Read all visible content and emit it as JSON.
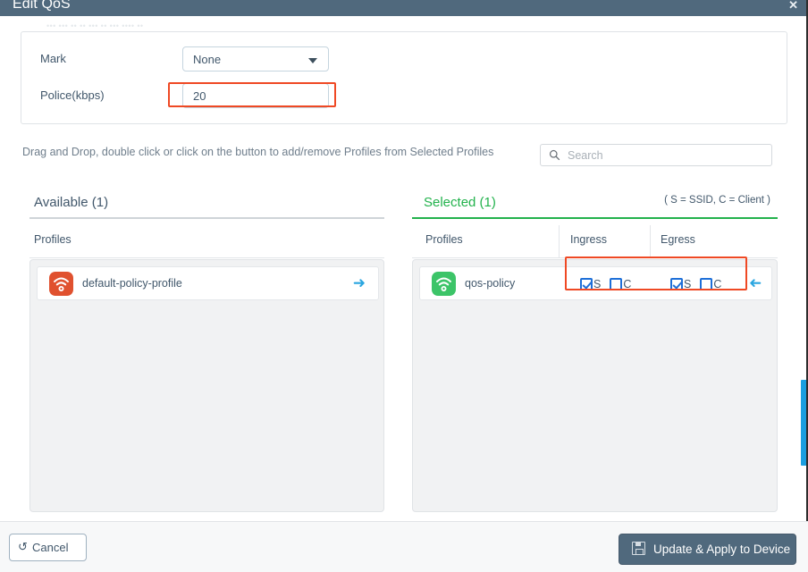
{
  "window": {
    "title": "Edit QoS",
    "close_label": "✕"
  },
  "ghost": {
    "text": "•••  •••  ••  ••    •••   •• ••• •••• ••"
  },
  "form": {
    "mark": {
      "label": "Mark",
      "value": "None",
      "caret_icon": "chevron-down-icon"
    },
    "police": {
      "label": "Police(kbps)",
      "value": "20"
    }
  },
  "instructions": {
    "text": "Drag and Drop, double click or click on the button to add/remove Profiles from Selected Profiles"
  },
  "search": {
    "icon": "search-icon",
    "value": "",
    "placeholder": "Search"
  },
  "available_panel": {
    "heading": "Available (1)",
    "column_header": "Profiles",
    "rows": [
      {
        "name": "default-policy-profile",
        "icon": "wifi-profile-icon",
        "icon_color": "#e0512f",
        "move_icon": "arrow-right-icon",
        "move_icon_glyph": "➜"
      }
    ]
  },
  "selected_panel": {
    "heading": "Selected (1)",
    "legend": "( S = SSID, C = Client )",
    "column_headers": {
      "profiles": "Profiles",
      "ingress": "Ingress",
      "egress": "Egress"
    },
    "rows": [
      {
        "name": "qos-policy",
        "icon": "wifi-profile-icon",
        "icon_color": "#3cc468",
        "ingress": {
          "ssid_label": "S",
          "ssid_checked": true,
          "client_label": "C",
          "client_checked": false
        },
        "egress": {
          "ssid_label": "S",
          "ssid_checked": true,
          "client_label": "C",
          "client_checked": false
        },
        "move_icon": "arrow-left-icon",
        "move_icon_glyph": "➜"
      }
    ]
  },
  "footer": {
    "cancel_label": "Cancel",
    "cancel_icon": "undo-icon",
    "cancel_icon_glyph": "↺",
    "apply_label": "Update & Apply to Device",
    "apply_icon": "save-disk-icon"
  },
  "colors": {
    "titlebar": "#50697d",
    "accent_green": "#22b24c",
    "highlight_red": "#ef4924",
    "checkbox_blue": "#1d6fd8",
    "arrow_blue": "#2ba6e0",
    "scrollbar_blue": "#1a9ee0",
    "primary_button": "#50697d"
  }
}
